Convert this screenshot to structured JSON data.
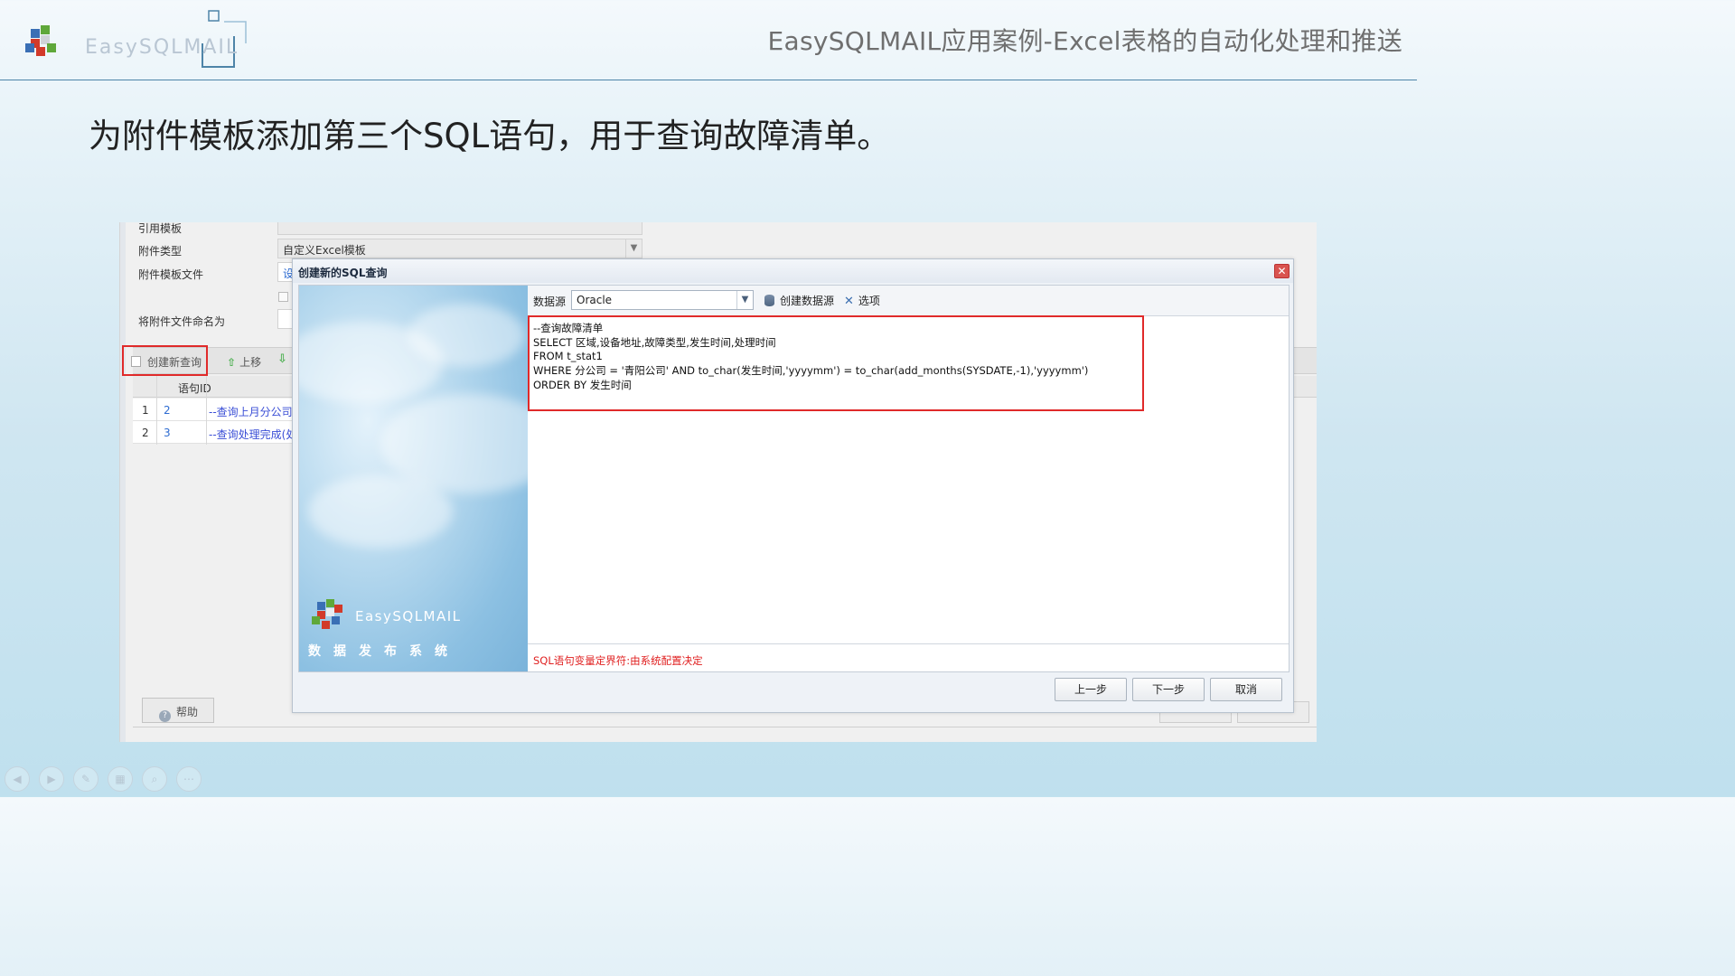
{
  "header": {
    "logo_text": "EasySQLMAIL",
    "slide_title": "EasySQLMAIL应用案例-Excel表格的自动化处理和推送",
    "subtitle": "为附件模板添加第三个SQL语句，用于查询故障清单。"
  },
  "app": {
    "fields": [
      {
        "label": "引用模板",
        "value": ""
      },
      {
        "label": "附件类型",
        "value": "自定义Excel模板"
      },
      {
        "label": "附件模板文件",
        "value": "设"
      },
      {
        "label": "将附件文件命名为",
        "value": ""
      }
    ],
    "toolbar": {
      "create_query": "创建新查询",
      "move_up": "上移"
    },
    "grid": {
      "header": "语句ID",
      "rows": [
        {
          "num": "1",
          "id": "2",
          "sql": "--查询上月分公司"
        },
        {
          "num": "2",
          "id": "3",
          "sql": "--查询处理完成(处"
        }
      ]
    },
    "help_button": "帮助"
  },
  "dialog": {
    "title": "创建新的SQL查询",
    "close_glyph": "✕",
    "datasource_label": "数据源",
    "datasource_value": "Oracle",
    "create_datasource": "创建数据源",
    "options": "选项",
    "sql_lines": [
      "--查询故障清单",
      "SELECT 区域,设备地址,故障类型,发生时间,处理时间",
      "FROM t_stat1",
      "WHERE 分公司 = '青阳公司'  AND to_char(发生时间,'yyyymm') = to_char(add_months(SYSDATE,-1),'yyyymm')",
      "ORDER BY 发生时间"
    ],
    "hint": "SQL语句变量定界符:由系统配置决定",
    "brand": "EasySQLMAIL",
    "tagline": "数据发布系统",
    "buttons": {
      "prev": "上一步",
      "next": "下一步",
      "cancel": "取消"
    }
  },
  "colors": {
    "accent_red": "#e02a2a",
    "header_line": "#4e84a8",
    "link_blue": "#3a4ed6"
  }
}
